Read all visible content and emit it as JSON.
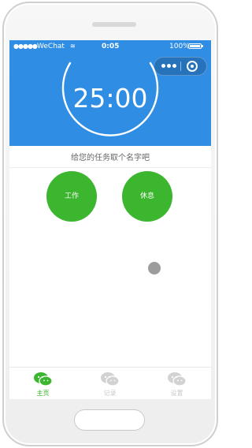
{
  "status_bar": {
    "signal": "●●●●●",
    "carrier": "WeChat",
    "time": "0:05",
    "battery_percent": "100%"
  },
  "capsule": {
    "more_icon": "three-dot-more-icon",
    "close_icon": "record-close-icon"
  },
  "timer": {
    "display": "25:00",
    "ring_color": "#ffffff"
  },
  "task": {
    "placeholder": "给您的任务取个名字吧"
  },
  "buttons": {
    "work": "工作",
    "rest": "休息"
  },
  "tabs": [
    {
      "label": "主页",
      "icon": "chat-bubbles-icon",
      "active": true
    },
    {
      "label": "记录",
      "icon": "chat-bubbles-icon",
      "active": false
    },
    {
      "label": "设置",
      "icon": "chat-bubbles-icon",
      "active": false
    }
  ],
  "colors": {
    "header": "#2f8de4",
    "accent": "#3cb52f",
    "inactive": "#c8c8c8"
  }
}
